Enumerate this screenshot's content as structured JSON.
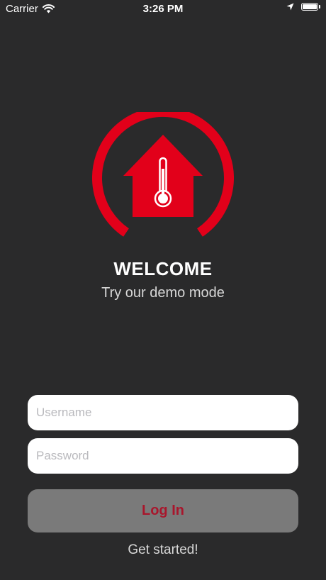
{
  "status_bar": {
    "carrier": "Carrier",
    "time": "3:26 PM",
    "icons": [
      "wifi-icon",
      "location-arrow-icon",
      "battery-icon"
    ]
  },
  "logo": {
    "icon": "house-thermometer-logo",
    "color": "#e2001a"
  },
  "welcome": {
    "title": "WELCOME",
    "subtitle": "Try our demo mode"
  },
  "login_form": {
    "username_placeholder": "Username",
    "password_placeholder": "Password",
    "login_label": "Log In",
    "get_started_label": "Get started!"
  },
  "colors": {
    "background": "#2a2a2b",
    "accent": "#e2001a",
    "button_bg": "#7a7a7a",
    "button_text": "#a8162c"
  }
}
